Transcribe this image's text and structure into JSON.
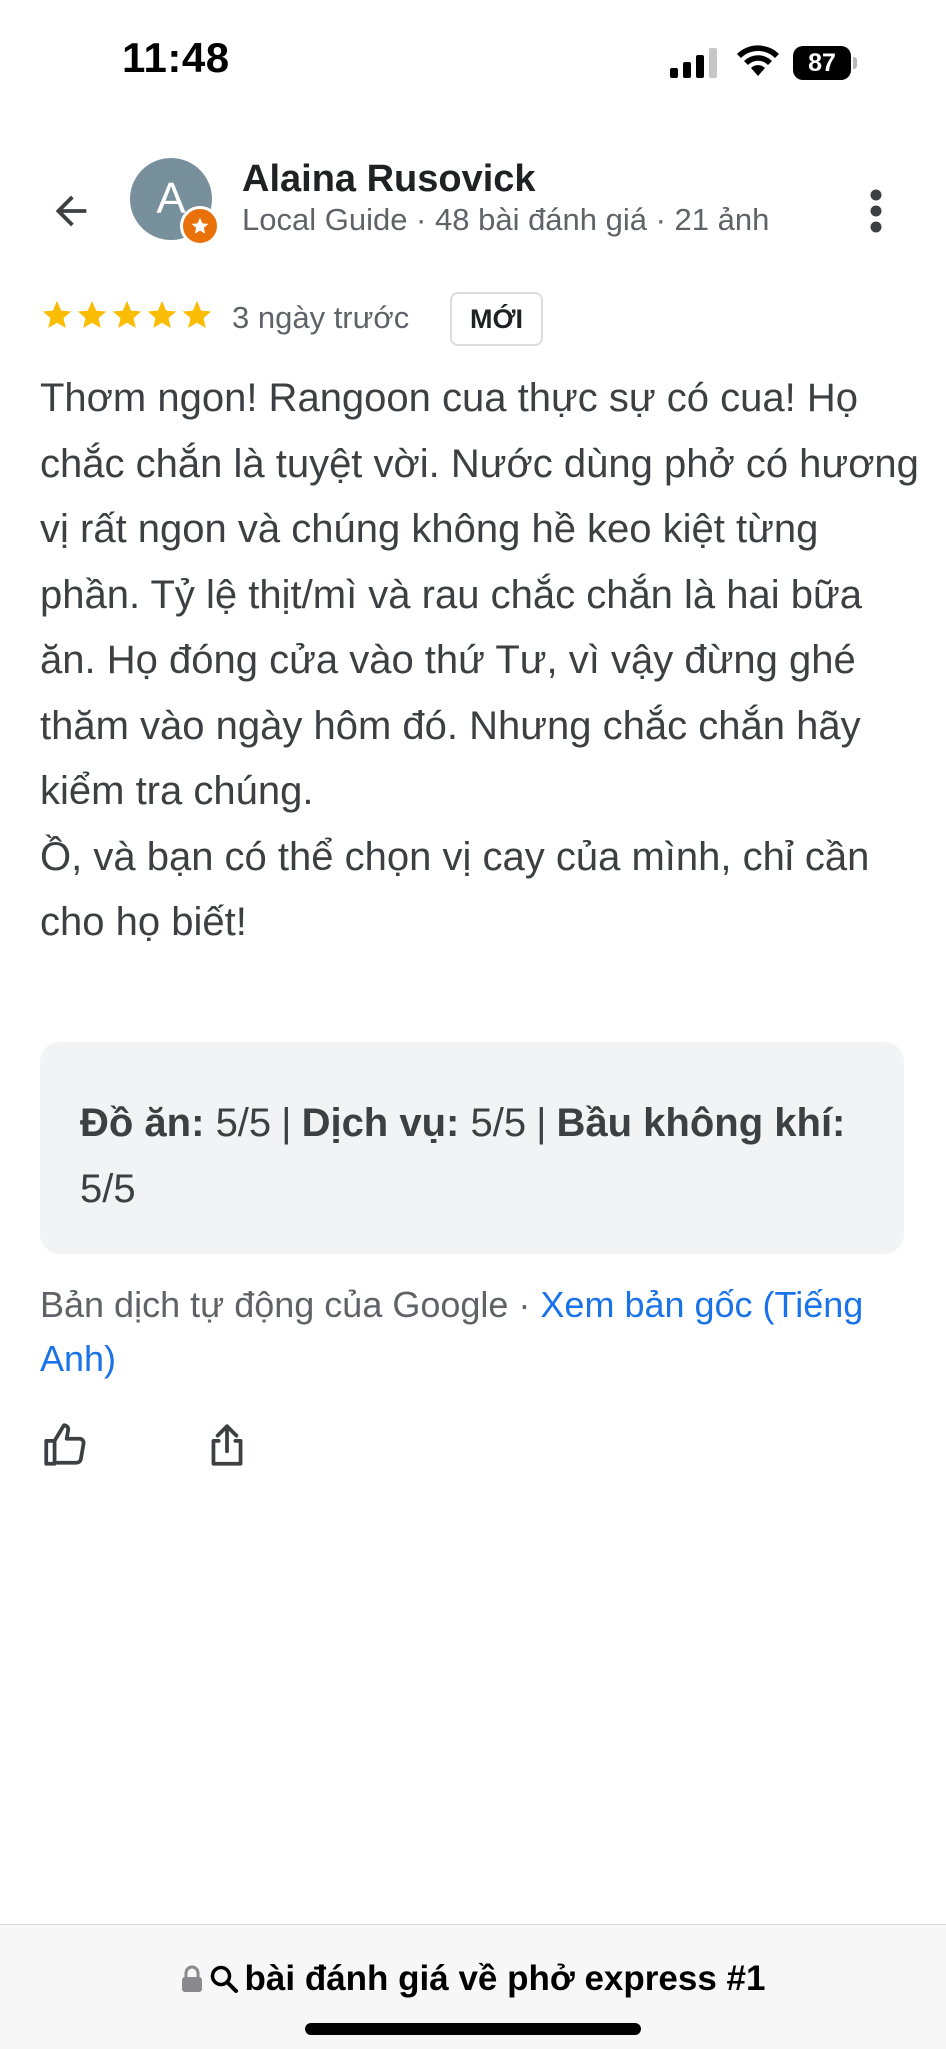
{
  "status_bar": {
    "time": "11:48",
    "battery": "87"
  },
  "header": {
    "avatar_letter": "A",
    "author_name": "Alaina Rusovick",
    "author_meta": "Local Guide · 48 bài đánh giá · 21 ảnh",
    "icons": {
      "back": "arrow-back-icon",
      "more": "more-vertical-icon",
      "badge": "local-guide-star-icon"
    }
  },
  "review": {
    "rating": 5,
    "max_rating": 5,
    "date": "3 ngày trước",
    "badge": "MỚI",
    "text_paragraph_1": "Thơm ngon! Rangoon cua thực sự có cua! Họ chắc chắn là tuyệt vời. Nước dùng phở có hương vị rất ngon và chúng không hề keo kiệt từng phần. Tỷ lệ thịt/mì và rau chắc chắn là hai bữa ăn. Họ đóng cửa vào thứ Tư, vì vậy đừng ghé thăm vào ngày hôm đó. Nhưng chắc chắn hãy kiểm tra chúng.",
    "text_paragraph_2": "Ồ, và bạn có thể chọn vị cay của mình, chỉ cần cho họ biết!"
  },
  "attributes": [
    {
      "label": "Đồ ăn:",
      "value": "5/5"
    },
    {
      "label": "Dịch vụ:",
      "value": "5/5"
    },
    {
      "label": "Bầu không khí:",
      "value": "5/5"
    }
  ],
  "translation": {
    "note": "Bản dịch tự động của Google",
    "link": "Xem bản gốc (Tiếng Anh)"
  },
  "actions": {
    "like_icon": "thumbs-up-icon",
    "share_icon": "share-icon"
  },
  "browser": {
    "url_text": "bài đánh giá về phở express #1"
  },
  "colors": {
    "star": "#fbbc04",
    "link": "#1a73e8",
    "avatar": "#78909c",
    "guide_badge": "#e8710a"
  }
}
